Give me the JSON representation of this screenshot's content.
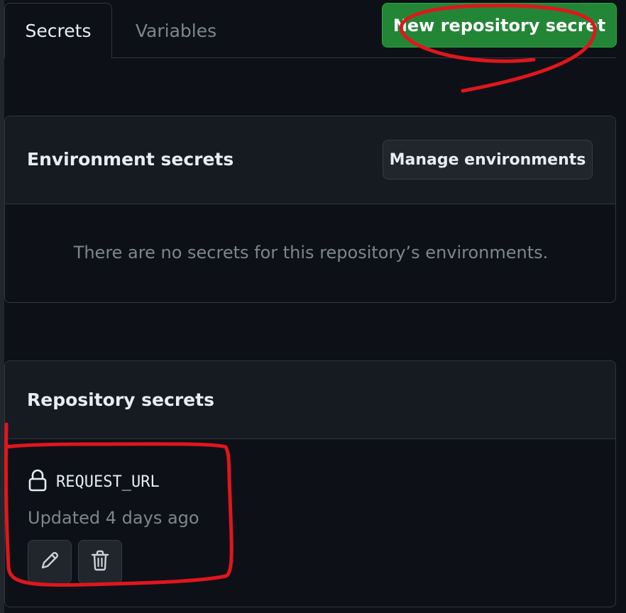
{
  "tabs": [
    {
      "label": "Secrets",
      "selected": true
    },
    {
      "label": "Variables",
      "selected": false
    }
  ],
  "actions": {
    "new_secret_label": "New repository secret"
  },
  "environment_secrets": {
    "title": "Environment secrets",
    "manage_button": "Manage environments",
    "empty_message": "There are no secrets for this repository’s environments."
  },
  "repository_secrets": {
    "title": "Repository secrets",
    "items": [
      {
        "name": "REQUEST_URL",
        "updated": "Updated 4 days ago",
        "icon": "lock-icon",
        "actions": [
          "pencil-icon",
          "trash-icon"
        ]
      }
    ]
  },
  "colors": {
    "background": "#0d1117",
    "panel_header": "#161b22",
    "border": "#30363d",
    "primary_button": "#238636",
    "text": "#e6edf3",
    "muted_text": "#7d8590",
    "annotation": "#e0161d"
  }
}
